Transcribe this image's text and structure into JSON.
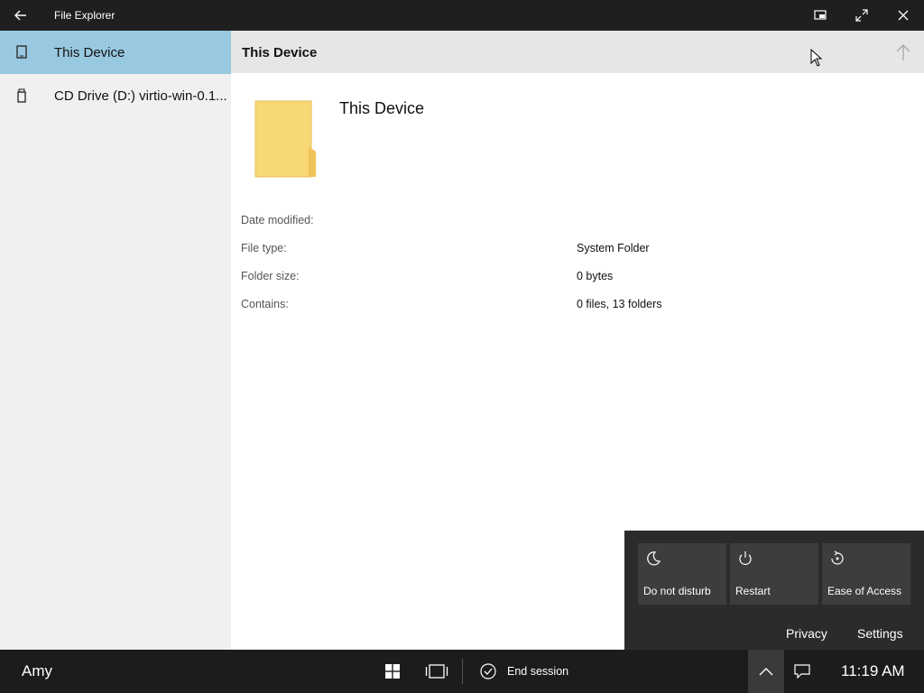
{
  "window": {
    "title": "File Explorer"
  },
  "sidebar": {
    "items": [
      {
        "label": "This Device",
        "icon": "device-icon",
        "selected": true
      },
      {
        "label": "CD Drive (D:) virtio-win-0.1...",
        "icon": "usb-drive-icon",
        "selected": false
      }
    ]
  },
  "main": {
    "header_title": "This Device",
    "item_title": "This Device",
    "properties": [
      {
        "key": "Date modified:",
        "value": ""
      },
      {
        "key": "File type:",
        "value": "System Folder"
      },
      {
        "key": "Folder size:",
        "value": "0 bytes"
      },
      {
        "key": "Contains:",
        "value": "0 files, 13 folders"
      }
    ]
  },
  "flyout": {
    "tiles": [
      {
        "label": "Do not disturb",
        "icon": "moon-icon"
      },
      {
        "label": "Restart",
        "icon": "power-icon"
      },
      {
        "label": "Ease of Access",
        "icon": "ease-of-access-icon"
      }
    ],
    "links": {
      "privacy": "Privacy",
      "settings": "Settings"
    }
  },
  "taskbar": {
    "user": "Amy",
    "end_session": "End session",
    "clock": "11:19 AM"
  },
  "colors": {
    "titlebar": "#1f1f1f",
    "selection": "#99c9e0",
    "sidebar": "#f0f0f0",
    "taskbar": "#1c1c1c",
    "flyout": "#2b2b2b",
    "folder": "#f8d775"
  }
}
